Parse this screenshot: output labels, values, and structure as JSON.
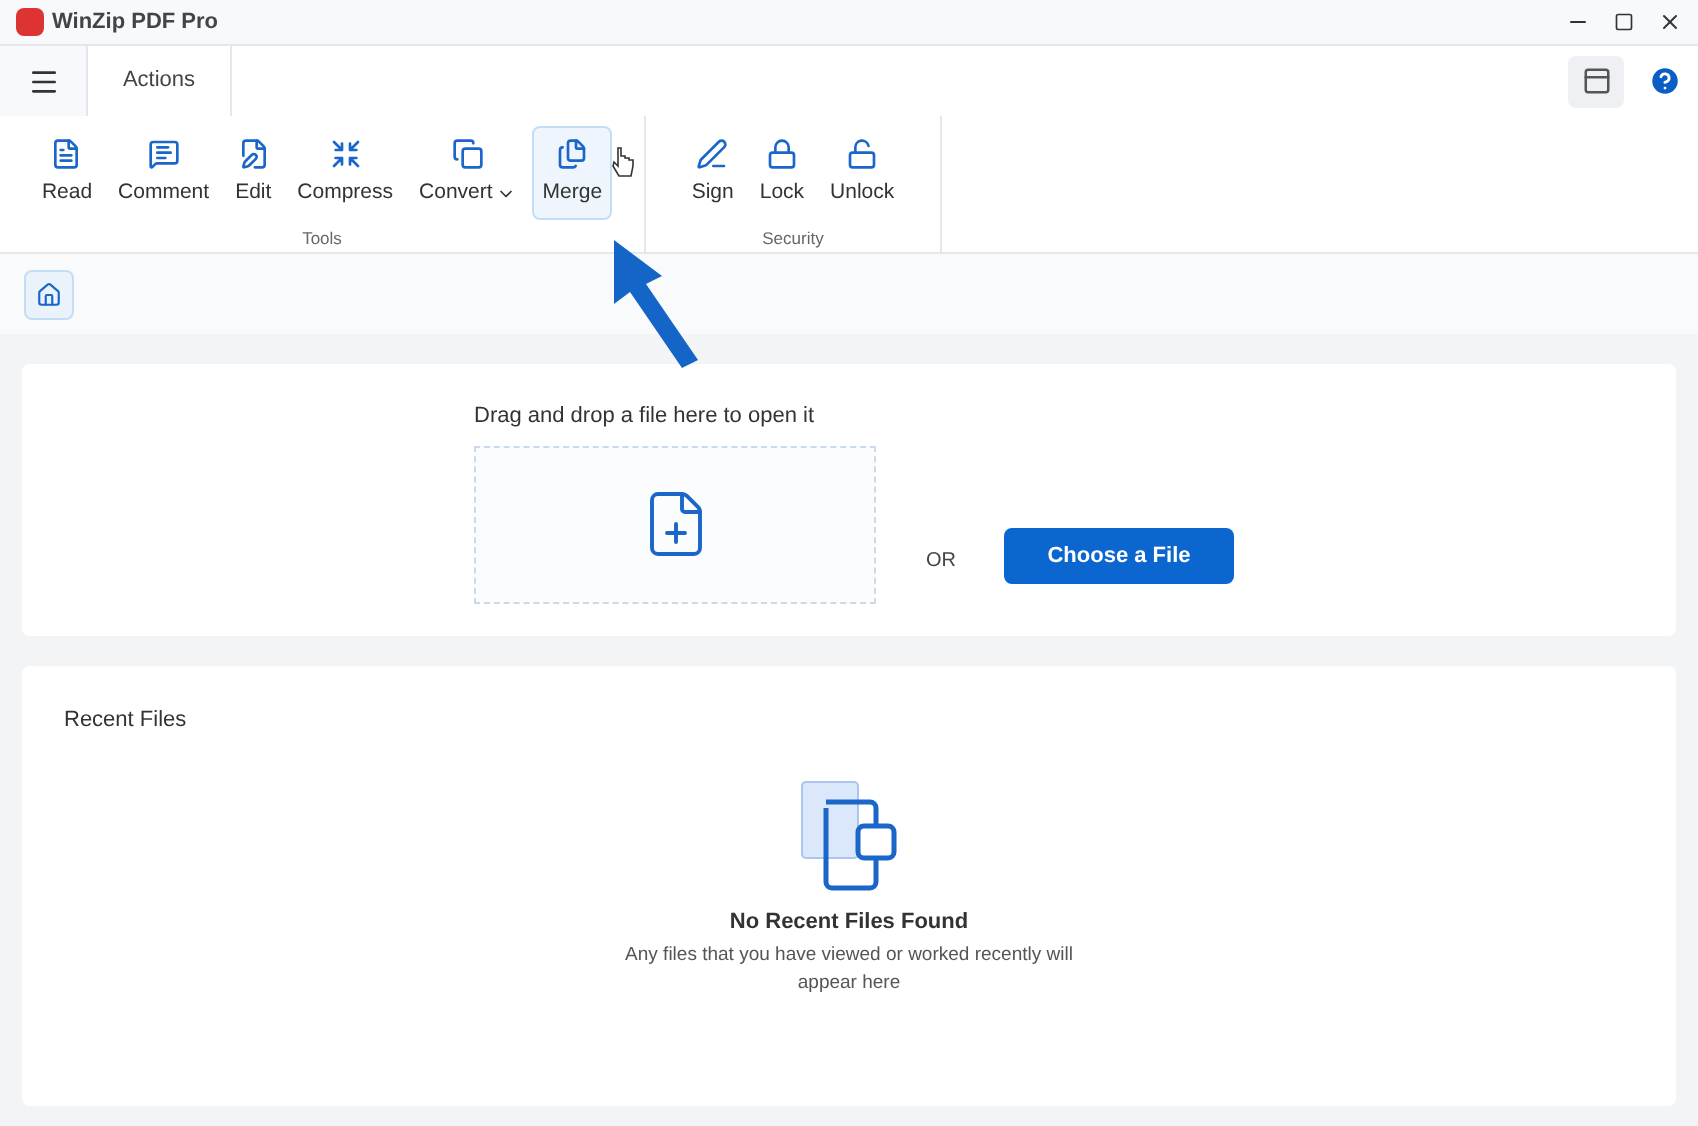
{
  "window": {
    "title": "WinZip PDF Pro"
  },
  "tabs": [
    {
      "label": "Actions",
      "selected": true
    }
  ],
  "ribbon": {
    "groups": [
      {
        "label": "Tools",
        "buttons": [
          {
            "label": "Read",
            "dropdown": false,
            "highlighted": false
          },
          {
            "label": "Comment",
            "dropdown": false,
            "highlighted": false
          },
          {
            "label": "Edit",
            "dropdown": false,
            "highlighted": false
          },
          {
            "label": "Compress",
            "dropdown": false,
            "highlighted": false
          },
          {
            "label": "Convert",
            "dropdown": true,
            "highlighted": false
          },
          {
            "label": "Merge",
            "dropdown": false,
            "highlighted": true
          }
        ]
      },
      {
        "label": "Security",
        "buttons": [
          {
            "label": "Sign",
            "dropdown": false,
            "highlighted": false
          },
          {
            "label": "Lock",
            "dropdown": false,
            "highlighted": false
          },
          {
            "label": "Unlock",
            "dropdown": false,
            "highlighted": false
          }
        ]
      }
    ]
  },
  "open_panel": {
    "prompt": "Drag and drop a file here to open it",
    "separator": "OR",
    "button": "Choose a File"
  },
  "recent_files": {
    "title": "Recent Files",
    "empty_title": "No Recent Files Found",
    "empty_text": "Any files that you have viewed or worked recently will appear here"
  }
}
